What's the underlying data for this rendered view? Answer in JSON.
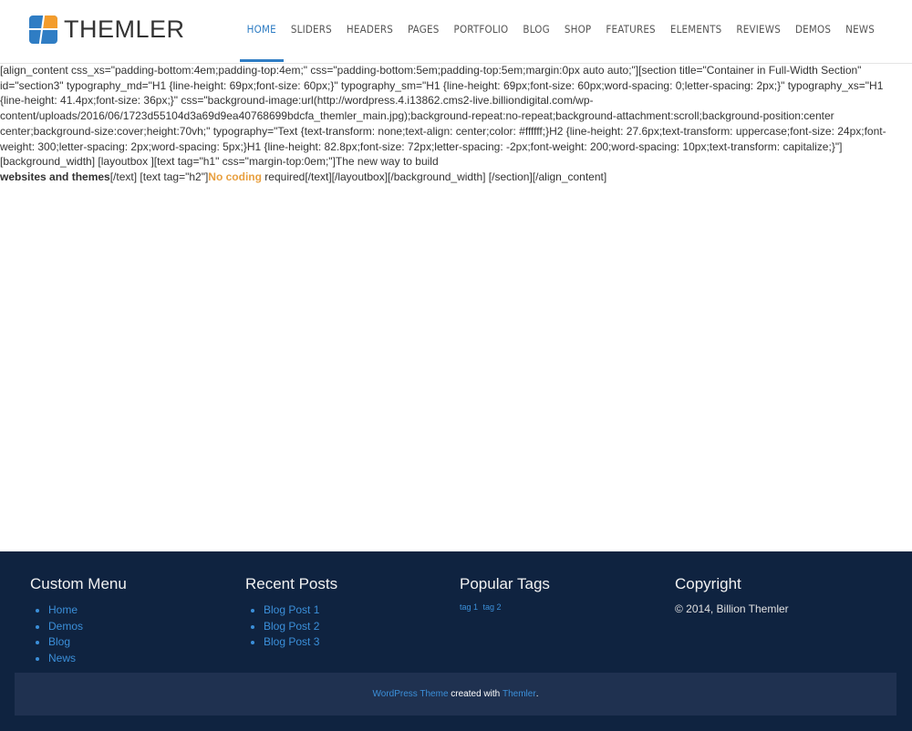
{
  "header": {
    "logo_text": "THEMLER",
    "nav": [
      {
        "label": "HOME",
        "active": true
      },
      {
        "label": "SLIDERS"
      },
      {
        "label": "HEADERS"
      },
      {
        "label": "PAGES"
      },
      {
        "label": "PORTFOLIO"
      },
      {
        "label": "BLOG"
      },
      {
        "label": "SHOP"
      },
      {
        "label": "FEATURES"
      },
      {
        "label": "ELEMENTS"
      },
      {
        "label": "REVIEWS"
      },
      {
        "label": "DEMOS"
      },
      {
        "label": "NEWS"
      }
    ]
  },
  "content": {
    "shortcode": "[align_content css_xs=\"padding-bottom:4em;padding-top:4em;\" css=\"padding-bottom:5em;padding-top:5em;margin:0px auto auto;\"][section title=\"Container in Full-Width Section\" id=\"section3\" typography_md=\"H1 {line-height: 69px;font-size: 60px;}\" typography_sm=\"H1 {line-height: 69px;font-size: 60px;word-spacing: 0;letter-spacing: 2px;}\" typography_xs=\"H1 {line-height: 41.4px;font-size: 36px;}\" css=\"background-image:url(http://wordpress.4.i13862.cms2-live.billiondigital.com/wp-content/uploads/2016/06/1723d55104d3a69d9ea40768699bdcfa_themler_main.jpg);background-repeat:no-repeat;background-attachment:scroll;background-position:center center;background-size:cover;height:70vh;\" typography=\"Text {text-transform: none;text-align: center;color: #ffffff;}H2 {line-height: 27.6px;text-transform: uppercase;font-size: 24px;font-weight: 300;letter-spacing: 2px;word-spacing: 5px;}H1 {line-height: 82.8px;font-size: 72px;letter-spacing: -2px;font-weight: 200;word-spacing: 10px;text-transform: capitalize;}\"] [background_width] [layoutbox ][text tag=\"h1\" css=\"margin-top:0em;\"]The new way to build",
    "bold_text": "websites and themes",
    "mid_text": "[/text] [text tag=\"h2\"]",
    "orange_text": "No coding",
    "tail_text": " required[/text][/layoutbox][/background_width] [/section][/align_content]"
  },
  "footer": {
    "custom_menu": {
      "title": "Custom Menu",
      "items": [
        "Home",
        "Demos",
        "Blog",
        "News"
      ]
    },
    "recent_posts": {
      "title": "Recent Posts",
      "items": [
        "Blog Post 1",
        "Blog Post 2",
        "Blog Post 3"
      ]
    },
    "popular_tags": {
      "title": "Popular Tags",
      "tags": [
        "tag 1",
        "tag 2"
      ]
    },
    "copyright": {
      "title": "Copyright",
      "text": "© 2014, Billion Themler"
    },
    "bottom": {
      "link1": "WordPress Theme",
      "middle": " created with ",
      "link2": "Themler",
      "end": "."
    }
  },
  "colors": {
    "accent": "#2f7dc4",
    "logo_orange": "#f39c2c",
    "footer_bg": "#0f2340",
    "footer_bar": "#1f3150",
    "link": "#3b8fd9"
  }
}
